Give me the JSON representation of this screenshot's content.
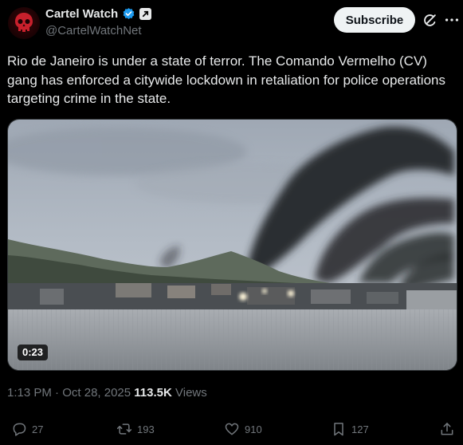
{
  "author": {
    "display_name": "Cartel Watch",
    "handle": "@CartelWatchNet",
    "avatar_icon": "red-skull-icon",
    "verified_icon": "verified-badge-icon",
    "affiliate_icon": "affiliate-badge-icon"
  },
  "header": {
    "subscribe_label": "Subscribe",
    "grok_icon": "grok-icon",
    "more_icon": "more-icon"
  },
  "post": {
    "text": "Rio de Janeiro is under a state of terror. The Comando Vermelho (CV) gang has enforced a citywide lockdown in retaliation for police operations targeting crime in the state.",
    "media": {
      "type": "video",
      "duration": "0:23"
    },
    "time": "1:13 PM",
    "separator": "·",
    "date": "Oct 28, 2025",
    "views_count": "113.5K",
    "views_label": "Views"
  },
  "actions": {
    "replies": "27",
    "reposts": "193",
    "likes": "910",
    "bookmarks": "127"
  },
  "colors": {
    "background": "#000000",
    "text_primary": "#e7e9ea",
    "text_secondary": "#71767b",
    "verified_blue": "#1d9bf0",
    "subscribe_bg": "#eff3f4"
  }
}
